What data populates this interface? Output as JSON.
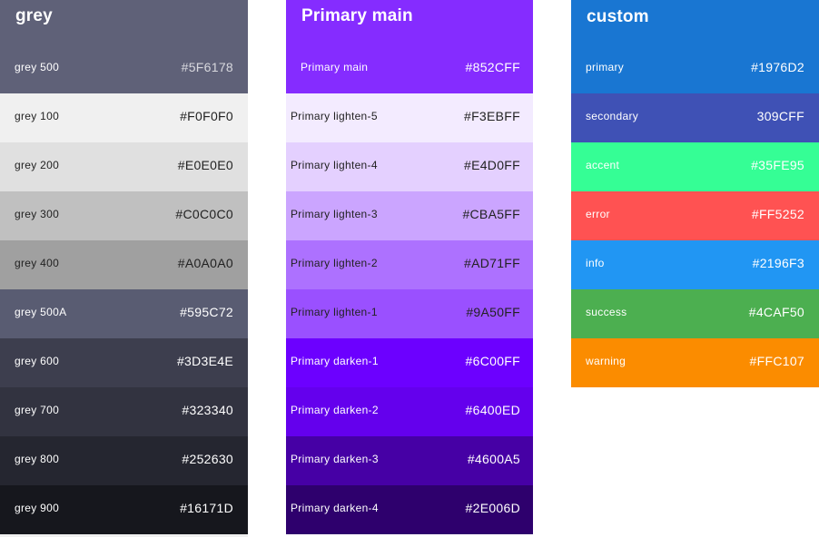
{
  "grey": {
    "title": "grey",
    "header_color": "#5F6178",
    "items": [
      {
        "name": "grey 500",
        "hex": "#5F6178",
        "bg": "#5F6178",
        "text": "muted"
      },
      {
        "name": "grey 100",
        "hex": "#F0F0F0",
        "bg": "#F0F0F0",
        "text": "dark"
      },
      {
        "name": "grey 200",
        "hex": "#E0E0E0",
        "bg": "#E0E0E0",
        "text": "dark"
      },
      {
        "name": "grey 300",
        "hex": "#C0C0C0",
        "bg": "#C0C0C0",
        "text": "dark"
      },
      {
        "name": "grey 400",
        "hex": "#A0A0A0",
        "bg": "#A0A0A0",
        "text": "dark"
      },
      {
        "name": "grey 500A",
        "hex": "#595C72",
        "bg": "#595C72",
        "text": "light"
      },
      {
        "name": "grey 600",
        "hex": "#3D3E4E",
        "bg": "#3D3E4E",
        "text": "light"
      },
      {
        "name": "grey 700",
        "hex": "#323340",
        "bg": "#323340",
        "text": "light"
      },
      {
        "name": "grey 800",
        "hex": "#252630",
        "bg": "#252630",
        "text": "light"
      },
      {
        "name": "grey 900",
        "hex": "#16171D",
        "bg": "#16171D",
        "text": "light"
      }
    ]
  },
  "primary": {
    "title": "Primary main",
    "header_color": "#852CFF",
    "items": [
      {
        "name": "Primary main",
        "hex": "#852CFF",
        "bg": "#852CFF",
        "text": "light"
      },
      {
        "name": "Primary  lighten-5",
        "hex": "#F3EBFF",
        "bg": "#F3EBFF",
        "text": "dark"
      },
      {
        "name": "Primary  lighten-4",
        "hex": "#E4D0FF",
        "bg": "#E4D0FF",
        "text": "dark"
      },
      {
        "name": "Primary  lighten-3",
        "hex": "#CBA5FF",
        "bg": "#CBA5FF",
        "text": "dark"
      },
      {
        "name": "Primary  lighten-2",
        "hex": "#AD71FF",
        "bg": "#AD71FF",
        "text": "dark"
      },
      {
        "name": "Primary  lighten-1",
        "hex": "#9A50FF",
        "bg": "#9A50FF",
        "text": "dark"
      },
      {
        "name": "Primary  darken-1",
        "hex": "#6C00FF",
        "bg": "#6C00FF",
        "text": "light"
      },
      {
        "name": "Primary  darken-2",
        "hex": "#6400ED",
        "bg": "#6400ED",
        "text": "light"
      },
      {
        "name": "Primary  darken-3",
        "hex": "#4600A5",
        "bg": "#4600A5",
        "text": "light"
      },
      {
        "name": "Primary  darken-4",
        "hex": "#2E006D",
        "bg": "#2E006D",
        "text": "light"
      }
    ]
  },
  "custom": {
    "title": "custom",
    "header_color": "#1976D2",
    "items": [
      {
        "name": "primary",
        "hex": "#1976D2",
        "bg": "#1976D2",
        "text": "light"
      },
      {
        "name": "secondary",
        "hex": "309CFF",
        "bg": "#3F51B5",
        "text": "light"
      },
      {
        "name": "accent",
        "hex": "#35FE95",
        "bg": "#35FE95",
        "text": "light"
      },
      {
        "name": "error",
        "hex": "#FF5252",
        "bg": "#FF5252",
        "text": "light"
      },
      {
        "name": "info",
        "hex": "#2196F3",
        "bg": "#2196F3",
        "text": "light"
      },
      {
        "name": "success",
        "hex": "#4CAF50",
        "bg": "#4CAF50",
        "text": "light"
      },
      {
        "name": "warning",
        "hex": "#FFC107",
        "bg": "#FB8C00",
        "text": "light"
      }
    ]
  }
}
